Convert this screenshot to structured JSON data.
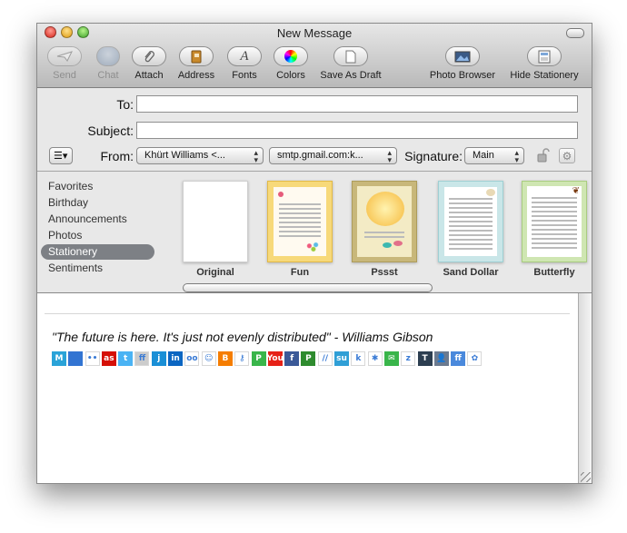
{
  "window": {
    "title": "New Message"
  },
  "toolbar": {
    "buttons": [
      {
        "label": "Send",
        "icon": "send-icon",
        "enabled": false
      },
      {
        "label": "Chat",
        "icon": "chat-icon",
        "enabled": false
      },
      {
        "label": "Attach",
        "icon": "paperclip-icon",
        "enabled": true
      },
      {
        "label": "Address",
        "icon": "address-book-icon",
        "enabled": true
      },
      {
        "label": "Fonts",
        "icon": "fonts-icon",
        "enabled": true
      },
      {
        "label": "Colors",
        "icon": "color-wheel-icon",
        "enabled": true
      },
      {
        "label": "Save As Draft",
        "icon": "draft-icon",
        "enabled": true
      },
      {
        "label": "Photo Browser",
        "icon": "photo-browser-icon",
        "enabled": true
      },
      {
        "label": "Hide Stationery",
        "icon": "stationery-icon",
        "enabled": true
      }
    ]
  },
  "header": {
    "to_label": "To:",
    "to_value": "",
    "subject_label": "Subject:",
    "subject_value": "",
    "from_label": "From:",
    "from_value": "Khürt Williams <...",
    "smtp_value": "smtp.gmail.com:k...",
    "signature_label": "Signature:",
    "signature_value": "Main"
  },
  "stationery": {
    "categories": [
      "Favorites",
      "Birthday",
      "Announcements",
      "Photos",
      "Stationery",
      "Sentiments"
    ],
    "selected_category": "Stationery",
    "templates": [
      {
        "label": "Original",
        "color": "#ffffff"
      },
      {
        "label": "Fun",
        "color": "#f7d97a"
      },
      {
        "label": "Pssst",
        "color": "#f2e4a8"
      },
      {
        "label": "Sand Dollar",
        "color": "#c9e6e8"
      },
      {
        "label": "Butterfly",
        "color": "#cfe6b2"
      }
    ]
  },
  "body": {
    "quote": "\"The future is here. It's just not evenly distributed\" - Williams Gibson",
    "social_icons": [
      {
        "name": "mybloglog-icon",
        "glyph": "M",
        "color": "#2aa3d8"
      },
      {
        "name": "delicious-icon",
        "glyph": "",
        "color": "#3274d2"
      },
      {
        "name": "flickr-icon",
        "glyph": "••",
        "color": "#ffffff"
      },
      {
        "name": "lastfm-icon",
        "glyph": "as",
        "color": "#d51007"
      },
      {
        "name": "twitter-icon",
        "glyph": "t",
        "color": "#4ab3f4"
      },
      {
        "name": "friendfeed-icon",
        "glyph": "ff",
        "color": "#cccccc"
      },
      {
        "name": "jaiku-icon",
        "glyph": "j",
        "color": "#1a8fd6"
      },
      {
        "name": "linkedin-icon",
        "glyph": "in",
        "color": "#0b66c2"
      },
      {
        "name": "cc-icon",
        "glyph": "oo",
        "color": "#ffffff"
      },
      {
        "name": "smiley-icon",
        "glyph": "☺",
        "color": "#ffffff"
      },
      {
        "name": "blogger-icon",
        "glyph": "B",
        "color": "#f57d00"
      },
      {
        "name": "key-icon",
        "glyph": "⚷",
        "color": "#ffffff"
      },
      {
        "name": "plurk-icon",
        "glyph": "P",
        "color": "#39b54a"
      },
      {
        "name": "youtube-icon",
        "glyph": "You",
        "color": "#e62117"
      },
      {
        "name": "facebook-icon",
        "glyph": "f",
        "color": "#3b5998"
      },
      {
        "name": "pownce-icon",
        "glyph": "P",
        "color": "#2e8b2e"
      },
      {
        "name": "netvibes-icon",
        "glyph": "//",
        "color": "#ffffff"
      },
      {
        "name": "stumbleupon-icon",
        "glyph": "su",
        "color": "#2f9fd6"
      },
      {
        "name": "kirtsy-icon",
        "glyph": "k",
        "color": "#ffffff"
      },
      {
        "name": "yelp-icon",
        "glyph": "✱",
        "color": "#ffffff"
      },
      {
        "name": "twitxr-icon",
        "glyph": "✉",
        "color": "#39b54a"
      },
      {
        "name": "zooomr-icon",
        "glyph": "z",
        "color": "#ffffff"
      },
      {
        "name": "tumblr-icon",
        "glyph": "T",
        "color": "#2c3e50"
      },
      {
        "name": "profile-icon",
        "glyph": "👤",
        "color": "#6b7a8f"
      },
      {
        "name": "ff-icon",
        "glyph": "ff",
        "color": "#4a89dc"
      },
      {
        "name": "flower-icon",
        "glyph": "✿",
        "color": "#ffffff"
      }
    ]
  }
}
